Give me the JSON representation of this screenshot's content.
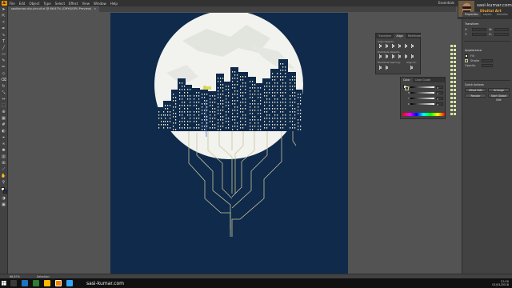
{
  "menubar": {
    "app_logo": "Ai",
    "items": [
      "File",
      "Edit",
      "Object",
      "Type",
      "Select",
      "Effect",
      "View",
      "Window",
      "Help"
    ],
    "workspace": "Essentials"
  },
  "document_tab": {
    "title": "sasikumar-city-circuit.ai @ 66.67% (CMYK/GPU Preview)",
    "close": "×"
  },
  "branding": {
    "site": "sasi-kumar.com",
    "tagline": "Digital Art Creation"
  },
  "align_panel": {
    "tabs": [
      "Transform",
      "Align",
      "Pathfinder"
    ],
    "active_tab": "Align",
    "sections": [
      "Align Objects:",
      "Distribute Objects:",
      "Distribute Spacing:",
      "Align To:"
    ]
  },
  "color_panel": {
    "tabs": [
      "Color",
      "Color Guide"
    ],
    "active_tab": "Color",
    "channels": [
      {
        "label": "C",
        "value": "0"
      },
      {
        "label": "M",
        "value": "0"
      },
      {
        "label": "Y",
        "value": "0"
      },
      {
        "label": "K",
        "value": "0"
      }
    ]
  },
  "properties_panel": {
    "tabs": [
      "Properties",
      "Layers",
      "Libraries"
    ],
    "sections": {
      "transform_title": "Transform",
      "x_label": "X:",
      "y_label": "Y:",
      "w_label": "W:",
      "h_label": "H:",
      "appearance_title": "Appearance",
      "fill_label": "Fill",
      "stroke_label": "Stroke",
      "opacity_label": "Opacity",
      "quick_actions_title": "Quick Actions",
      "offset_path": "Offset Path",
      "arrange": "Arrange",
      "recolor": "Recolor",
      "start_global_edit": "Start Global Edit"
    }
  },
  "statusbar": {
    "zoom": "66.67%",
    "mode": "Selection"
  },
  "taskbar": {
    "url": "sasi-kumar.com",
    "time": "12:00",
    "date": "01/01/2018"
  },
  "colors": {
    "artboard_bg": "#0f2a4a",
    "moon": "#f2f2ee",
    "city": "#102a4c",
    "circuit_line": "#c9c49a",
    "window_light": "#f5efc8"
  }
}
